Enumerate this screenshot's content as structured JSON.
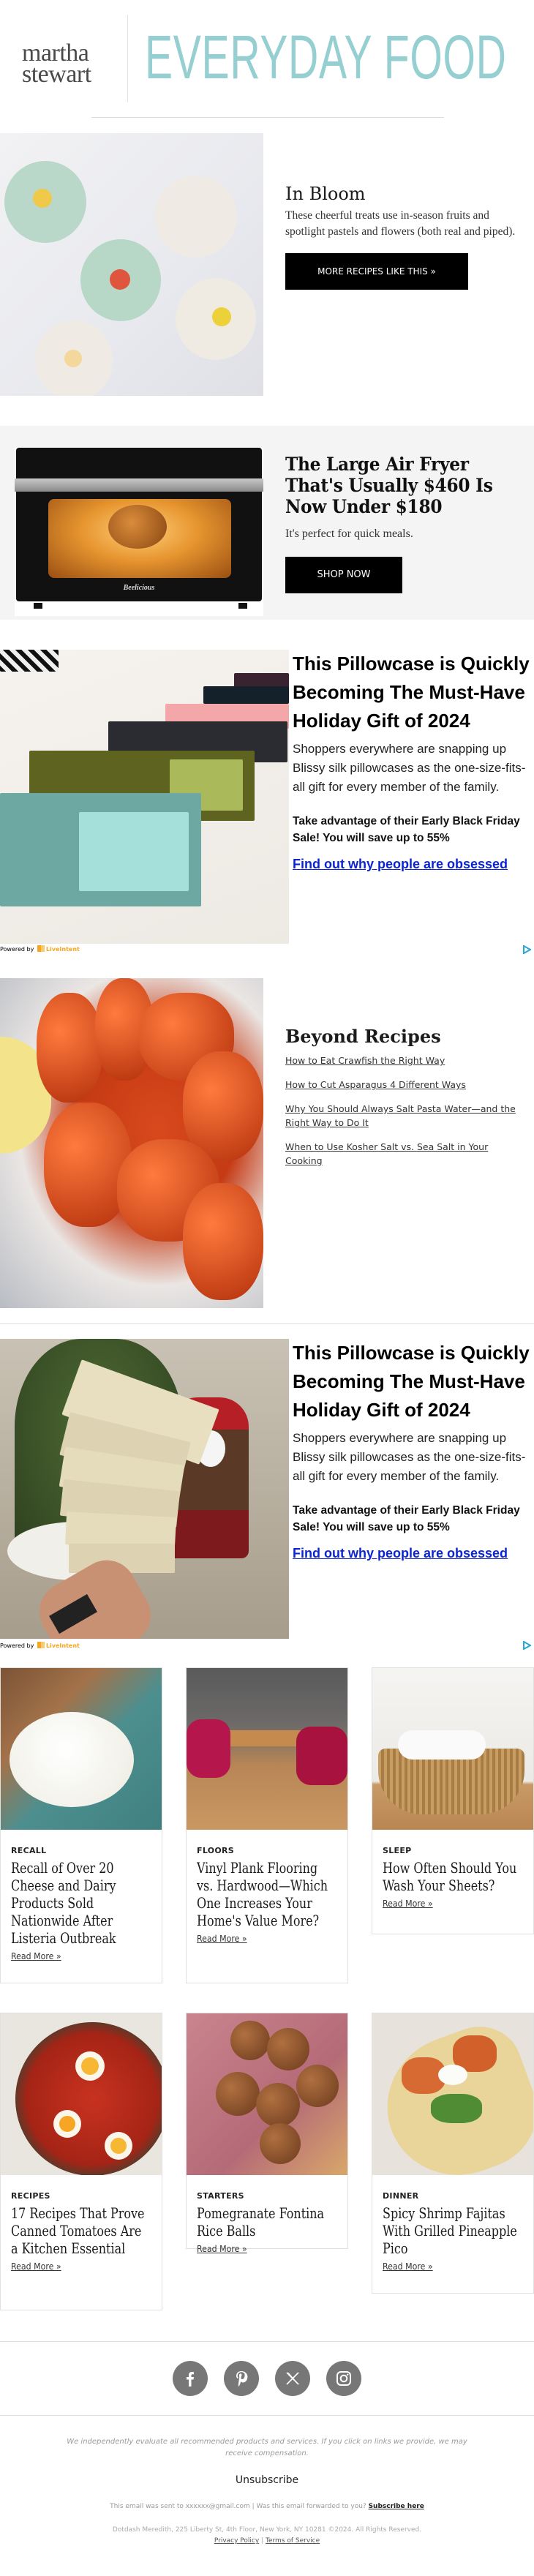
{
  "header": {
    "logo_line1": "martha",
    "logo_line2": "stewart",
    "brand": "EVERYDAY FOOD",
    "brand_color": "#95cfd1"
  },
  "feature": {
    "title": "In Bloom",
    "description": "These cheerful treats use in-season fruits and spotlight pastels and flowers (both real and piped).",
    "button": "MORE RECIPES LIKE THIS »",
    "image_alt": "Flower-decorated cupcakes"
  },
  "promo": {
    "title": "The Large Air Fryer That's Usually $460 Is Now Under $180",
    "description": "It's perfect for quick meals.",
    "button": "SHOP NOW",
    "product_brand": "Beelicious"
  },
  "ads": [
    {
      "title": "This Pillowcase is Quickly Becoming The Must-Have Holiday Gift of 2024",
      "body": "Shoppers everywhere are snapping up Blissy silk pillowcases as the one-size-fits-all gift for every member of the family.",
      "bold": "Take advantage of their Early Black Friday Sale! You will save up to 55%",
      "link": "Find out why people are obsessed",
      "powered_by": "Powered by",
      "provider": "LiveIntent"
    },
    {
      "title": "This Pillowcase is Quickly Becoming The Must-Have Holiday Gift of 2024",
      "body": "Shoppers everywhere are snapping up Blissy silk pillowcases as the one-size-fits-all gift for every member of the family.",
      "bold": "Take advantage of their Early Black Friday Sale! You will save up to 55%",
      "link": "Find out why people are obsessed",
      "powered_by": "Powered by",
      "provider": "LiveIntent"
    }
  ],
  "beyond": {
    "title": "Beyond Recipes",
    "links": [
      "How to Eat Crawfish the Right Way",
      "How to Cut Asparagus 4 Different Ways",
      "Why You Should Always Salt Pasta Water—and the Right Way to Do It",
      "When to Use Kosher Salt vs. Sea Salt in Your Cooking"
    ]
  },
  "cards": [
    {
      "category": "RECALL",
      "title": "Recall of Over 20 Cheese and Dairy Products Sold Nationwide After Listeria Outbreak",
      "more": "Read More »"
    },
    {
      "category": "FLOORS",
      "title": "Vinyl Plank Flooring vs. Hardwood—Which One Increases Your Home's Value More?",
      "more": "Read More »"
    },
    {
      "category": "SLEEP",
      "title": "How Often Should You Wash Your Sheets?",
      "more": "Read More »"
    },
    {
      "category": "RECIPES",
      "title": "17 Recipes That Prove Canned Tomatoes Are a Kitchen Essential",
      "more": "Read More »"
    },
    {
      "category": "STARTERS",
      "title": "Pomegranate Fontina Rice Balls",
      "more": "Read More »"
    },
    {
      "category": "DINNER",
      "title": "Spicy Shrimp Fajitas With Grilled Pineapple Pico",
      "more": "Read More »"
    }
  ],
  "footer": {
    "social": [
      "facebook-icon",
      "pinterest-icon",
      "x-icon",
      "instagram-icon"
    ],
    "disclaimer": "We independently evaluate all recommended products and services. If you click on links we provide, we may receive compensation.",
    "unsubscribe": "Unsubscribe",
    "sent_to": "This email was sent to xxxxxx@gmail.com  |  Was this email forwarded to you?",
    "subscribe_here": "Subscribe here",
    "address": "Dotdash Meredith, 225 Liberty St, 4th Floor, New York, NY 10281 ©2024. All Rights Reserved.",
    "privacy": "Privacy Policy",
    "separator": "|",
    "terms": "Terms of Service"
  }
}
